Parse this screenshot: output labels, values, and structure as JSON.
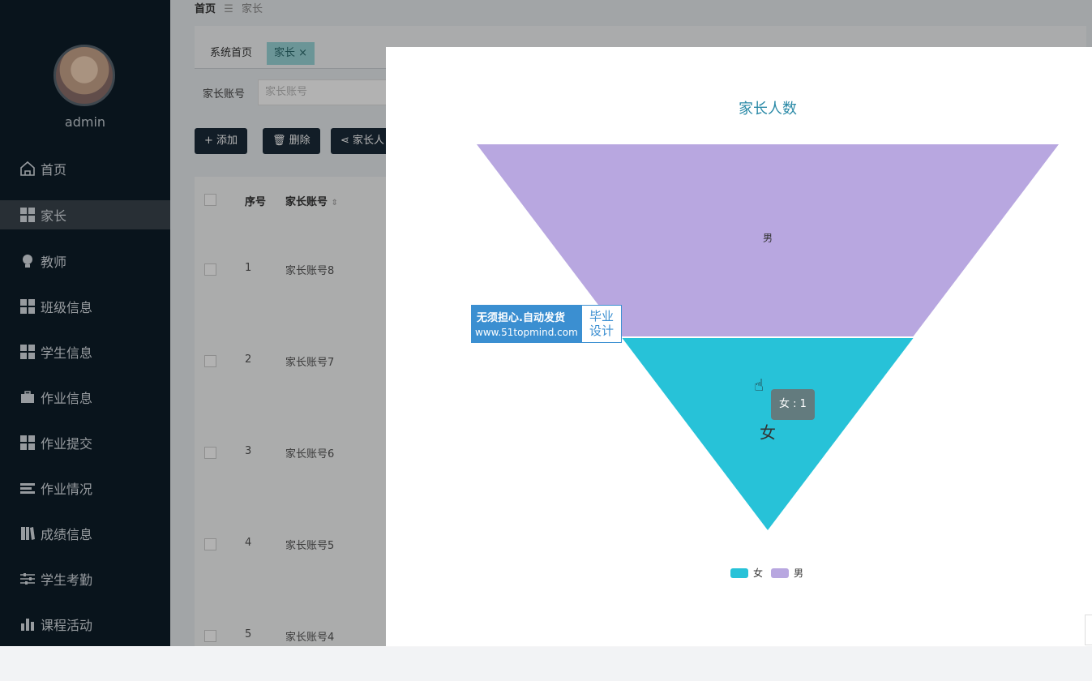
{
  "sidebar": {
    "username": "admin",
    "items": [
      {
        "label": "首页",
        "icon": "home-icon"
      },
      {
        "label": "家长",
        "icon": "grid-icon",
        "active": true
      },
      {
        "label": "教师",
        "icon": "bulb-icon"
      },
      {
        "label": "班级信息",
        "icon": "grid-icon"
      },
      {
        "label": "学生信息",
        "icon": "grid-icon"
      },
      {
        "label": "作业信息",
        "icon": "briefcase-icon"
      },
      {
        "label": "作业提交",
        "icon": "grid-icon"
      },
      {
        "label": "作业情况",
        "icon": "list-icon"
      },
      {
        "label": "成绩信息",
        "icon": "book-icon"
      },
      {
        "label": "学生考勤",
        "icon": "sliders-icon"
      },
      {
        "label": "课程活动",
        "icon": "bar-chart-icon"
      }
    ]
  },
  "breadcrumb": {
    "home": "首页",
    "sep": "☰",
    "current": "家长"
  },
  "tabs": {
    "home": "系统首页",
    "current": "家长",
    "close": "×"
  },
  "search": {
    "label": "家长账号",
    "placeholder": "家长账号"
  },
  "buttons": {
    "add": "添加",
    "delete": "删除",
    "stats": "家长人"
  },
  "table": {
    "headers": {
      "index": "序号",
      "account": "家长账号"
    },
    "rows": [
      {
        "index": "1",
        "account": "家长账号8"
      },
      {
        "index": "2",
        "account": "家长账号7"
      },
      {
        "index": "3",
        "account": "家长账号6"
      },
      {
        "index": "4",
        "account": "家长账号5"
      },
      {
        "index": "5",
        "account": "家长账号4"
      }
    ]
  },
  "watermark": {
    "line1": "无须担心.自动发货",
    "line2": "www.51topmind.com",
    "right1": "毕业",
    "right2": "设计"
  },
  "tooltip": "女 : 1",
  "colors": {
    "male": "#b8a7e0",
    "female": "#27c2d8",
    "title": "#2b8aa7",
    "sidebar": "#0d1d29"
  },
  "chart_data": {
    "type": "funnel",
    "title": "家长人数",
    "categories": [
      "男",
      "女"
    ],
    "values": [
      2,
      1
    ],
    "legend": [
      "女",
      "男"
    ],
    "legend_position": "bottom"
  }
}
